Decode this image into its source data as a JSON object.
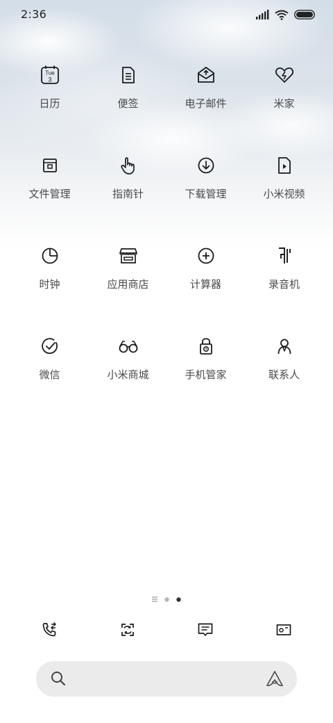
{
  "status_bar": {
    "time": "2:36"
  },
  "home_grid": {
    "apps": [
      {
        "label": "日历",
        "icon": "calendar-icon",
        "calendar_day": "Tue",
        "calendar_date": "3"
      },
      {
        "label": "便签",
        "icon": "notes-icon"
      },
      {
        "label": "电子邮件",
        "icon": "email-icon"
      },
      {
        "label": "米家",
        "icon": "mi-home-icon"
      },
      {
        "label": "文件管理",
        "icon": "file-manager-icon"
      },
      {
        "label": "指南针",
        "icon": "compass-icon"
      },
      {
        "label": "下载管理",
        "icon": "downloads-icon"
      },
      {
        "label": "小米视频",
        "icon": "mi-video-icon"
      },
      {
        "label": "时钟",
        "icon": "clock-icon"
      },
      {
        "label": "应用商店",
        "icon": "app-store-icon"
      },
      {
        "label": "计算器",
        "icon": "calculator-icon"
      },
      {
        "label": "录音机",
        "icon": "recorder-icon"
      },
      {
        "label": "微信",
        "icon": "wechat-icon"
      },
      {
        "label": "小米商城",
        "icon": "mi-store-icon"
      },
      {
        "label": "手机管家",
        "icon": "security-icon"
      },
      {
        "label": "联系人",
        "icon": "contacts-icon"
      }
    ]
  },
  "page_indicator": {
    "pages": 3,
    "current_page": 3
  },
  "dock": {
    "items": [
      "phone-icon",
      "camera-icon",
      "messages-icon",
      "gallery-icon"
    ]
  },
  "search_bar": {
    "left_icon": "search-icon",
    "right_icon": "assistant-icon"
  },
  "colors": {
    "icon_stroke": "#1a1a1a",
    "label_text": "#4a4a4a",
    "search_bg": "#ebebeb"
  }
}
